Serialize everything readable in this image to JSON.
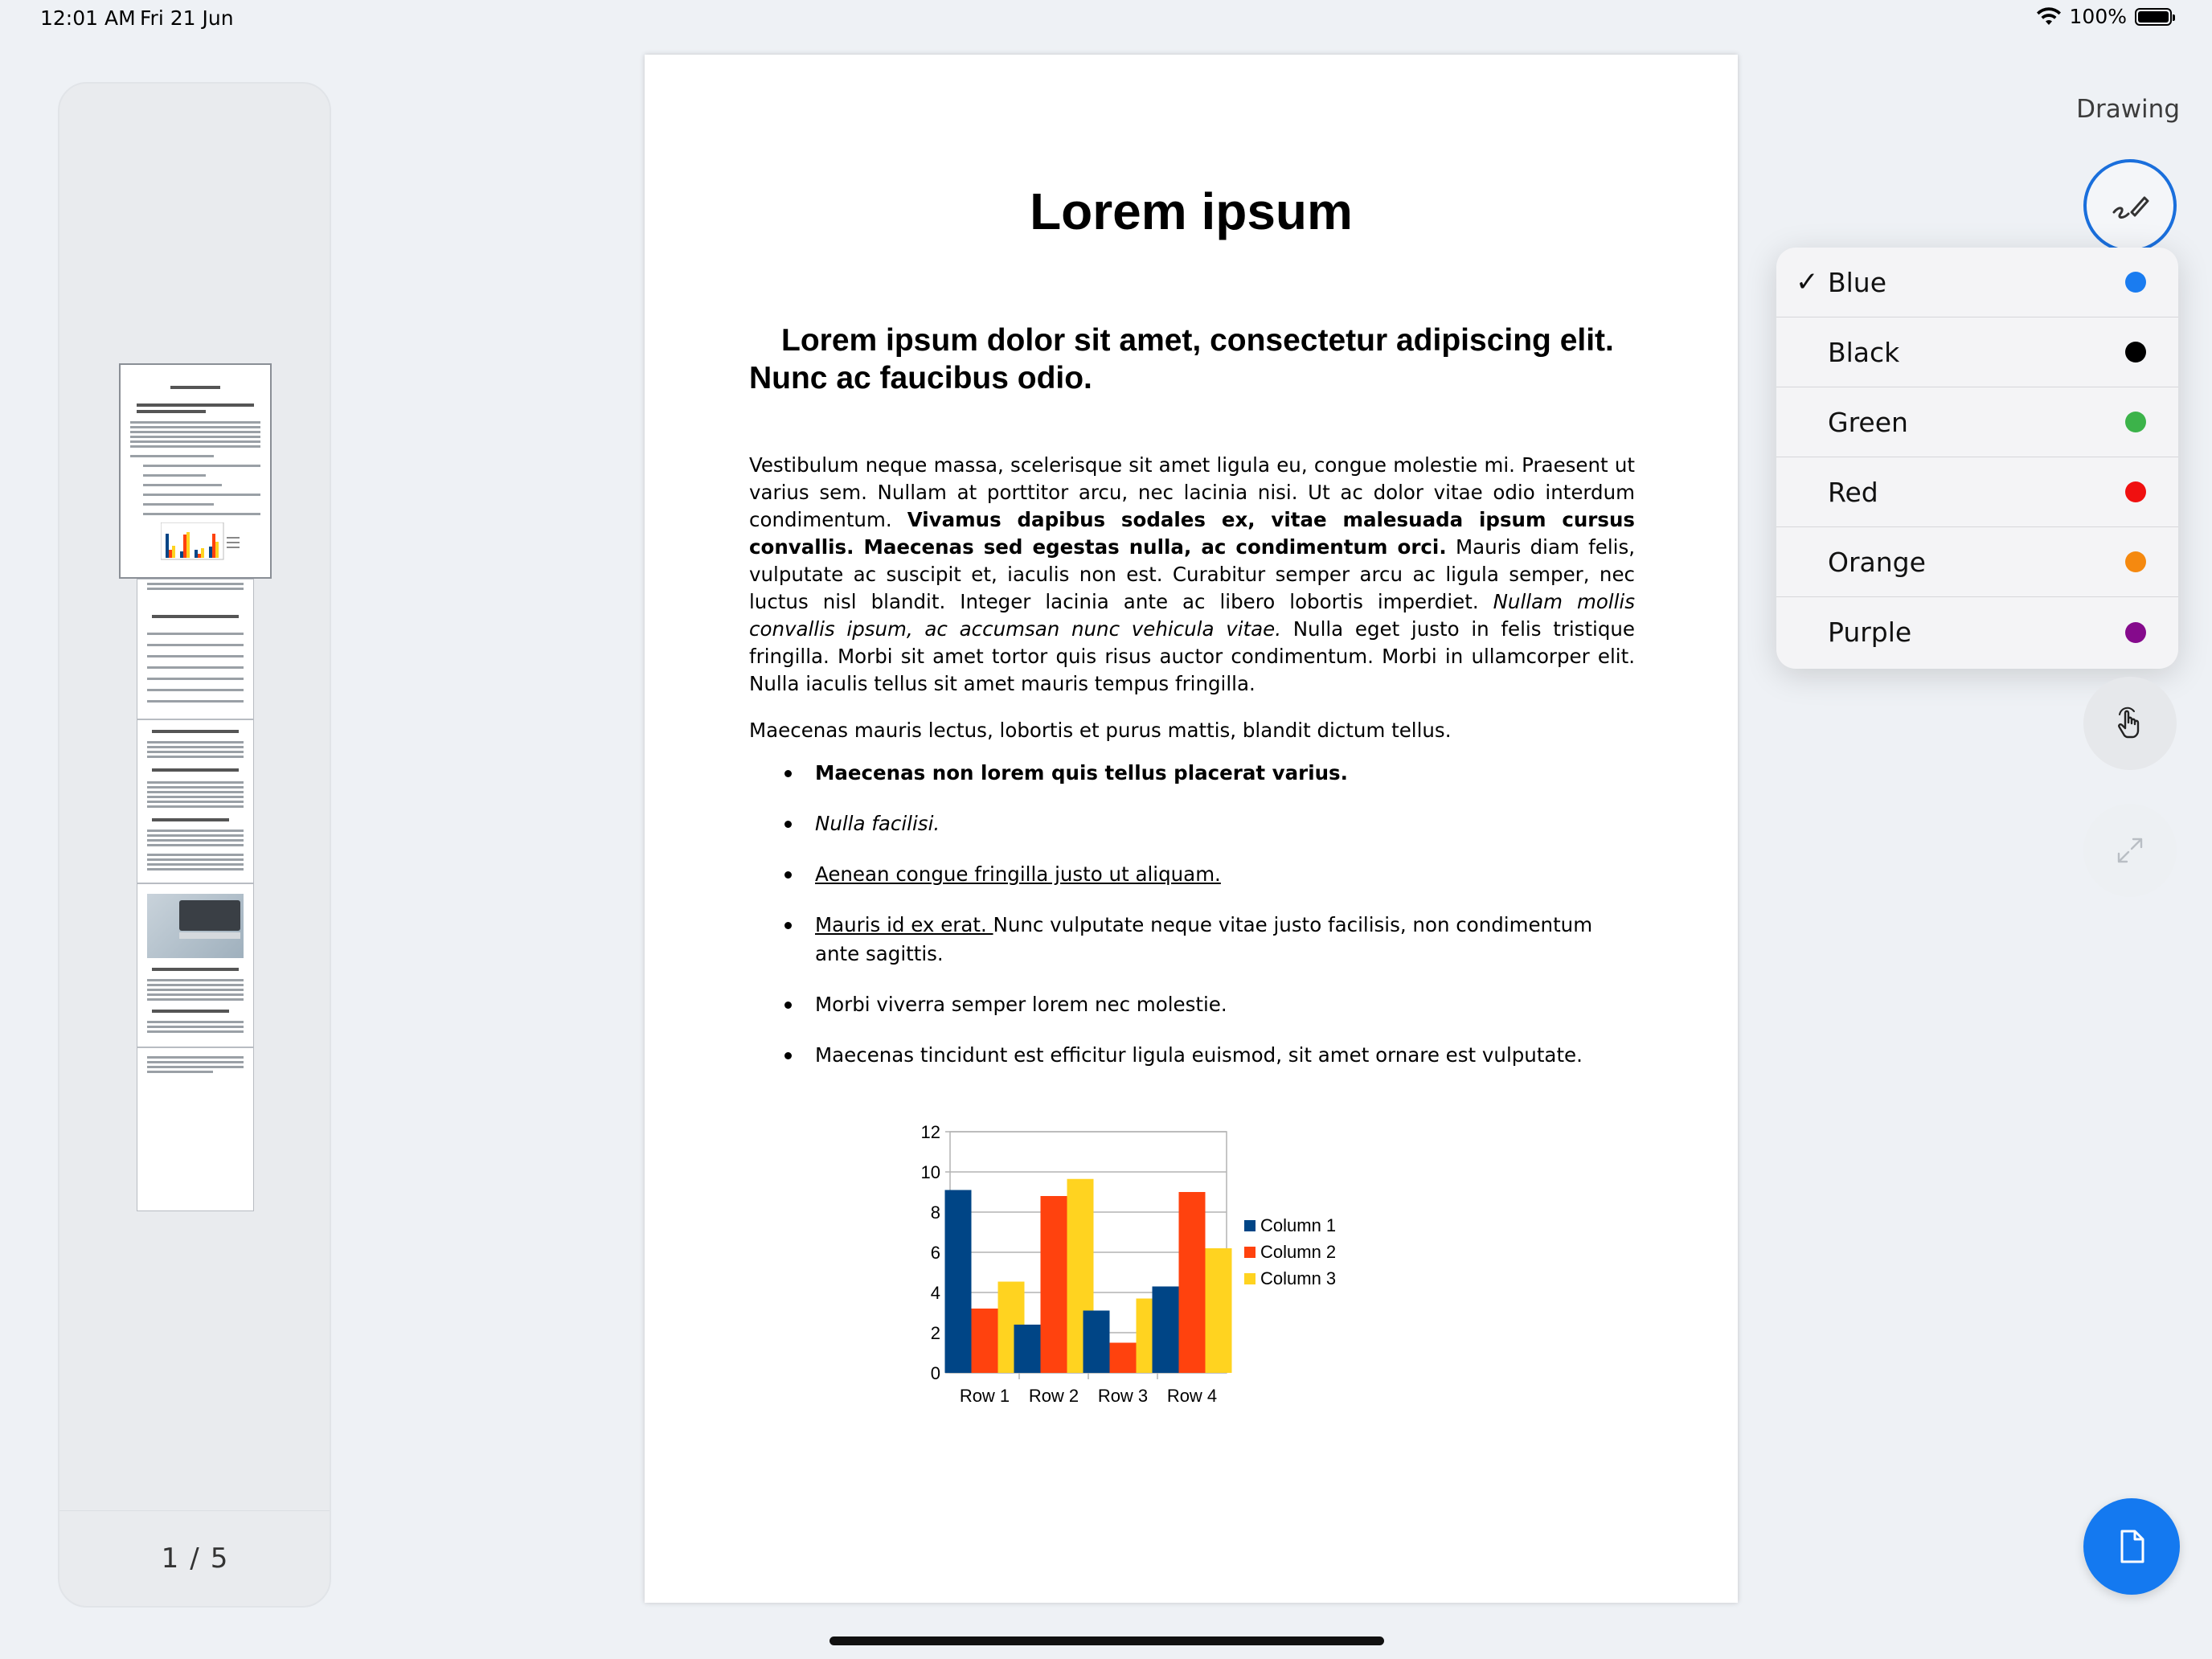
{
  "status_bar": {
    "time": "12:01 AM",
    "date": "Fri 21 Jun",
    "battery": "100%"
  },
  "sidebar": {
    "current_page": "1",
    "separator": "/",
    "total_pages": "5"
  },
  "document": {
    "title": "Lorem ipsum",
    "subtitle": "Lorem ipsum dolor sit amet, consectetur adipiscing elit. Nunc ac faucibus odio.",
    "para1": {
      "p1": "Vestibulum neque massa, scelerisque sit amet ligula eu, congue molestie mi. Praesent ut varius sem. Nullam at porttitor arcu, nec lacinia nisi. Ut ac dolor vitae odio interdum condimentum. ",
      "p2_bold": "Vivamus dapibus sodales ex, vitae malesuada ipsum cursus convallis. Maecenas sed egestas nulla, ac condimentum orci.",
      "p3": " Mauris diam felis, vulputate ac suscipit et, iaculis non est. Curabitur semper arcu ac ligula semper, nec luctus nisl blandit. Integer lacinia ante ac libero lobortis imperdiet. ",
      "p4_italic": "Nullam mollis convallis ipsum, ac accumsan nunc vehicula vitae.",
      "p5": " Nulla eget justo in felis tristique fringilla. Morbi sit amet tortor quis risus auctor condimentum. Morbi in ullamcorper elit. Nulla iaculis tellus sit amet mauris tempus fringilla."
    },
    "para2": "Maecenas mauris lectus, lobortis et purus mattis, blandit dictum tellus.",
    "list": {
      "item1": "Maecenas non lorem quis tellus placerat varius.",
      "item2": "Nulla facilisi.",
      "item3": "Aenean congue fringilla justo ut aliquam. ",
      "item4_link": "Mauris id ex erat. ",
      "item4_rest": "Nunc vulputate neque vitae justo facilisis, non condimentum ante sagittis.",
      "item5": "Morbi viverra semper lorem nec molestie.",
      "item6": "Maecenas tincidunt est efficitur ligula euismod, sit amet ornare est vulputate."
    }
  },
  "chart_data": {
    "type": "bar",
    "categories": [
      "Row 1",
      "Row 2",
      "Row 3",
      "Row 4"
    ],
    "series": [
      {
        "name": "Column 1",
        "color": "#004586",
        "values": [
          9.1,
          2.4,
          3.1,
          4.3
        ]
      },
      {
        "name": "Column 2",
        "color": "#ff420e",
        "values": [
          3.2,
          8.8,
          1.5,
          9
        ]
      },
      {
        "name": "Column 3",
        "color": "#ffd320",
        "values": [
          4.54,
          9.65,
          3.7,
          6.2
        ]
      }
    ],
    "ylim": [
      0,
      12
    ],
    "yticks": [
      "0",
      "2",
      "4",
      "6",
      "8",
      "10",
      "12"
    ],
    "grid": true,
    "legend": "right"
  },
  "tools": {
    "title": "Drawing",
    "pen_icon": "pen-icon",
    "hand_icon": "hand-pointer-icon",
    "expand_icon": "expand-icon",
    "fab_icon": "document-icon",
    "accent": "#1479f0"
  },
  "color_menu": {
    "selected_mark": "✓",
    "items": [
      {
        "label": "Blue",
        "color": "#1a7cf0"
      },
      {
        "label": "Black",
        "color": "#000000"
      },
      {
        "label": "Green",
        "color": "#3cb34a"
      },
      {
        "label": "Red",
        "color": "#f01010"
      },
      {
        "label": "Orange",
        "color": "#f5890f"
      },
      {
        "label": "Purple",
        "color": "#850a8c"
      }
    ]
  }
}
